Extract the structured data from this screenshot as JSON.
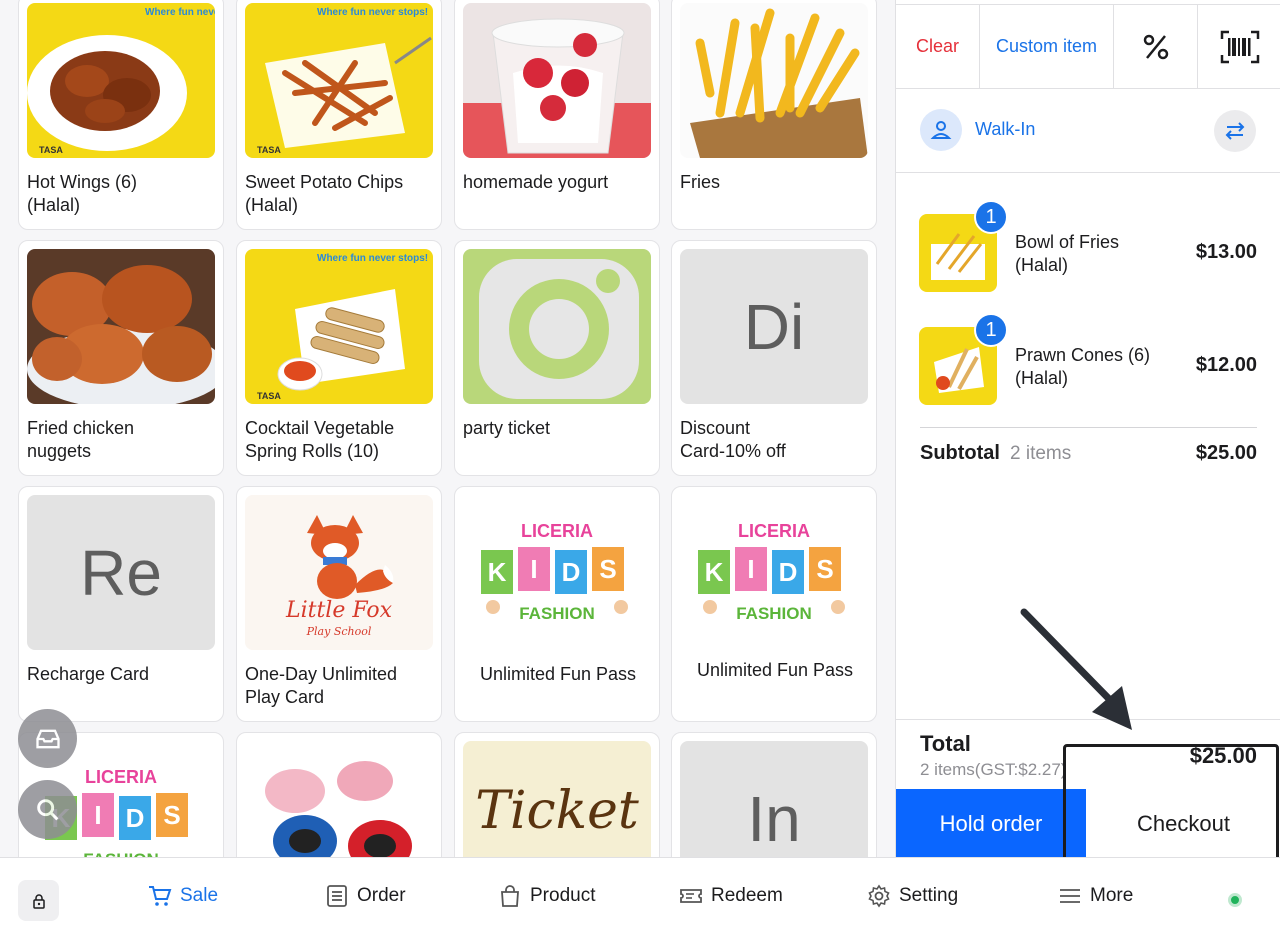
{
  "products": [
    {
      "name": "Hot Wings (6)\n(Halal)",
      "thumb": "hot-wings-photo"
    },
    {
      "name": "Sweet Potato Chips\n(Halal)",
      "thumb": "sweet-potato-chips-photo"
    },
    {
      "name": "homemade yogurt",
      "thumb": "yogurt-photo"
    },
    {
      "name": "Fries",
      "thumb": "fries-photo"
    },
    {
      "name": "Fried chicken\nnuggets",
      "thumb": "chicken-nuggets-photo"
    },
    {
      "name": "Cocktail Vegetable\nSpring Rolls (10)",
      "thumb": "spring-rolls-photo"
    },
    {
      "name": "party ticket",
      "thumb": "instagram-placeholder"
    },
    {
      "name": "Discount\nCard-10% off",
      "thumb": "initials",
      "initials": "Di"
    },
    {
      "name": "Recharge Card",
      "thumb": "initials",
      "initials": "Re"
    },
    {
      "name": "One-Day Unlimited\nPlay Card",
      "thumb": "little-fox-logo",
      "logo_text": "Little Fox",
      "logo_sub": "Play School"
    },
    {
      "name": "Unlimited Fun Pass",
      "thumb": "liceria-kids-logo"
    },
    {
      "name": "Unlimited Fun Pass",
      "thumb": "liceria-kids-logo"
    },
    {
      "name": "",
      "thumb": "liceria-kids-logo"
    },
    {
      "name": "",
      "thumb": "knee-pads-photo"
    },
    {
      "name": "",
      "thumb": "ticket-script",
      "script_text": "Ticket"
    },
    {
      "name": "",
      "thumb": "initials",
      "initials": "In"
    }
  ],
  "brand_tagline": "Where fun never stops!",
  "liceria_logo": {
    "top": "LICERIA",
    "letters": [
      "K",
      "I",
      "D",
      "S"
    ],
    "bottom": "FASHION"
  },
  "toolbar": {
    "clear": "Clear",
    "custom_item": "Custom item",
    "discount_icon": "percent-icon",
    "scan_icon": "barcode-icon"
  },
  "customer": {
    "name": "Walk-In"
  },
  "cart": [
    {
      "qty": "1",
      "name": "Bowl of Fries\n(Halal)",
      "price": "$13.00"
    },
    {
      "qty": "1",
      "name": "Prawn Cones (6)\n(Halal)",
      "price": "$12.00"
    }
  ],
  "subtotal": {
    "label": "Subtotal",
    "count": "2 items",
    "amount": "$25.00"
  },
  "total": {
    "label": "Total",
    "sub": "2 items(GST:$2.27)",
    "amount": "$25.00"
  },
  "actions": {
    "hold": "Hold order",
    "checkout": "Checkout"
  },
  "nav": {
    "sale": "Sale",
    "order": "Order",
    "product": "Product",
    "redeem": "Redeem",
    "setting": "Setting",
    "more": "More"
  },
  "colors": {
    "accent": "#1a73e8",
    "hold": "#0a66ff",
    "clear": "#e5303a",
    "online": "#20b35b"
  }
}
